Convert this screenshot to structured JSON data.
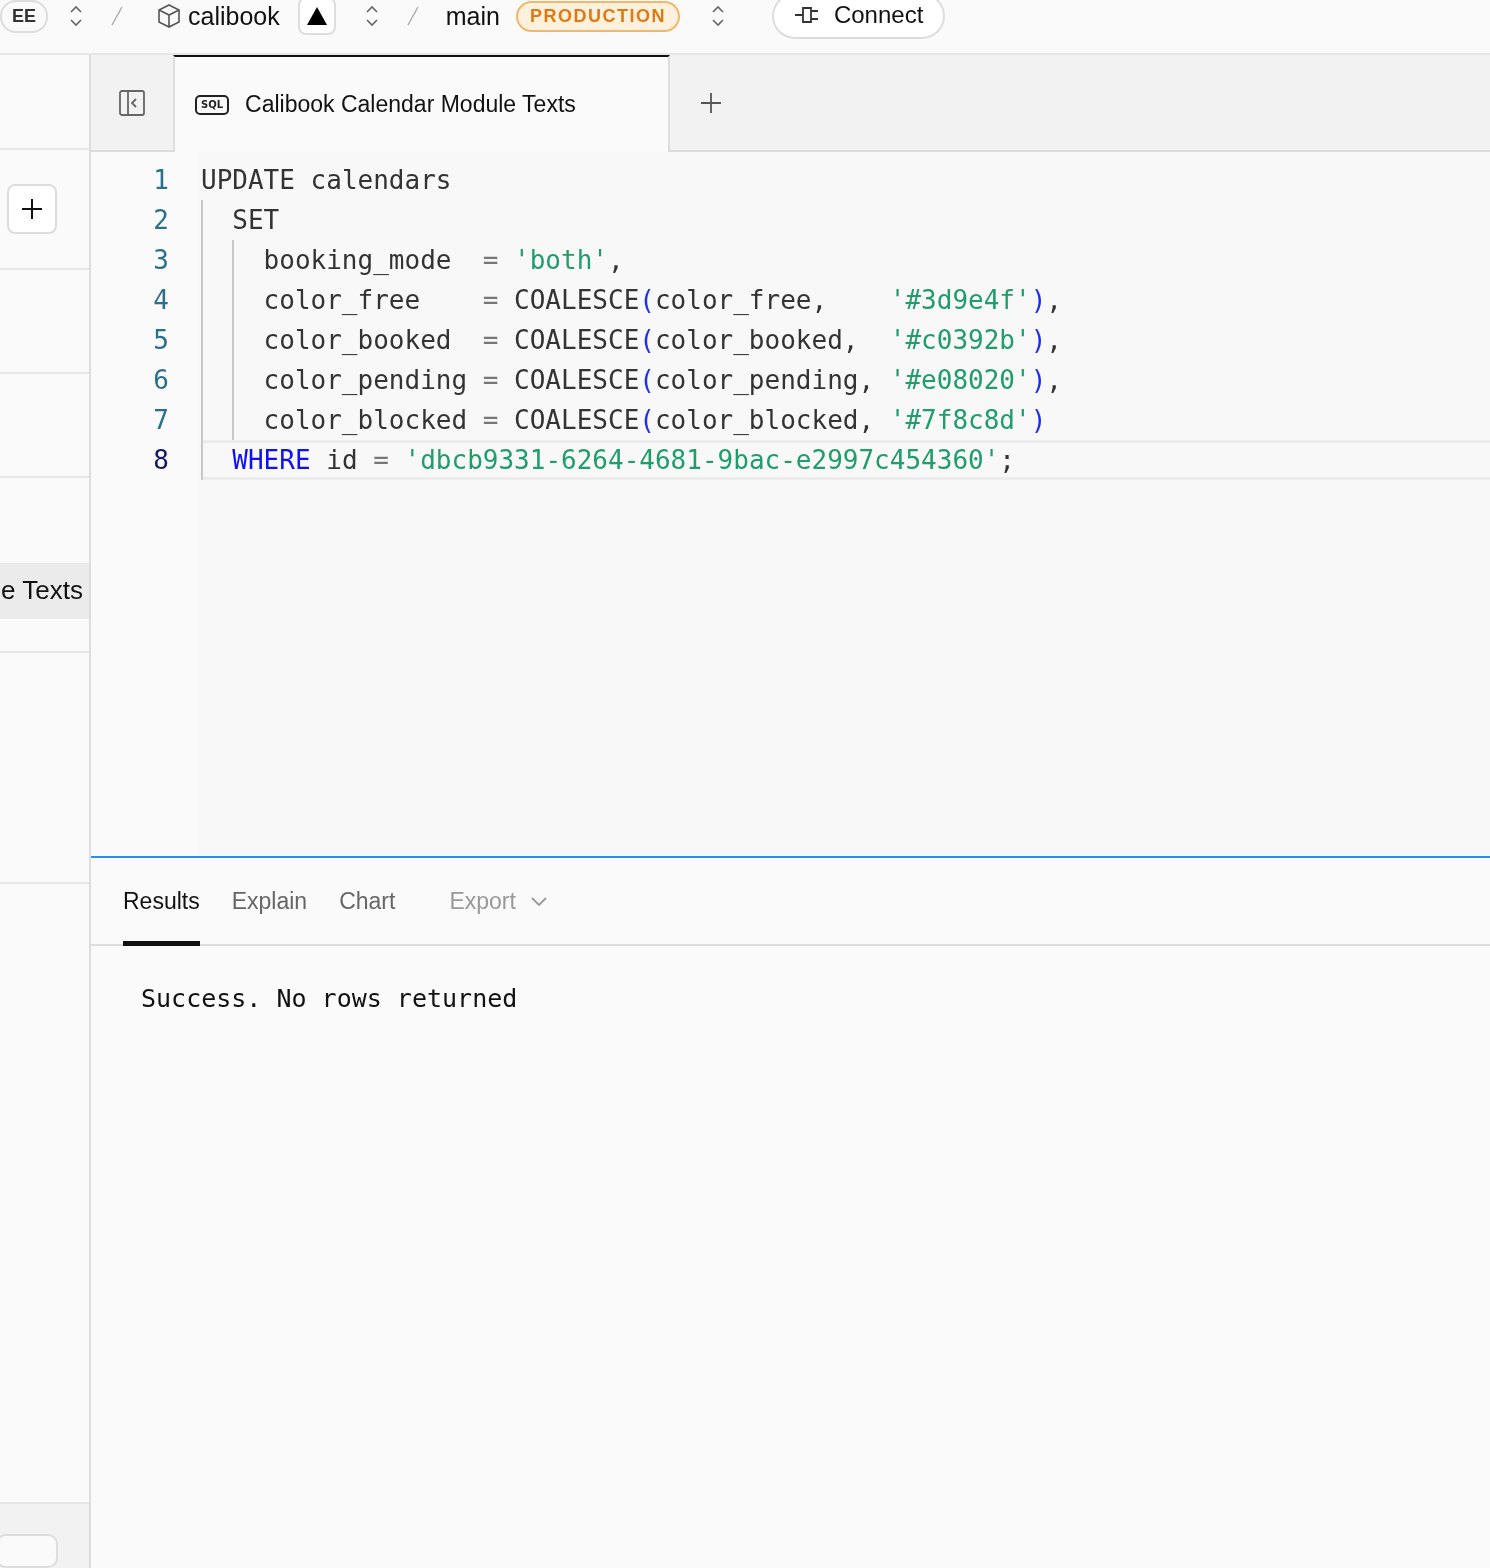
{
  "topbar": {
    "org_badge": "EE",
    "project": "calibook",
    "branch": "main",
    "environment": "PRODUCTION",
    "connect_button": "Connect"
  },
  "sidebar": {
    "items": [
      {
        "label": "e Texts",
        "selected": true
      }
    ]
  },
  "editor_tabs": [
    {
      "badge": "SQL",
      "label": "Calibook Calendar Module Texts",
      "selected": true
    }
  ],
  "editor": {
    "lines": [
      {
        "number": "1",
        "active": false,
        "tokens": [
          {
            "kind": "plain",
            "text": "UPDATE calendars"
          }
        ]
      },
      {
        "number": "2",
        "active": false,
        "tokens": [
          {
            "kind": "plain",
            "text": "  SET"
          }
        ]
      },
      {
        "number": "3",
        "active": false,
        "tokens": [
          {
            "kind": "plain",
            "text": "    booking_mode  "
          },
          {
            "kind": "operator",
            "text": "= "
          },
          {
            "kind": "string",
            "text": "'both'"
          },
          {
            "kind": "plain",
            "text": ","
          }
        ]
      },
      {
        "number": "4",
        "active": false,
        "tokens": [
          {
            "kind": "plain",
            "text": "    color_free    "
          },
          {
            "kind": "operator",
            "text": "="
          },
          {
            "kind": "plain",
            "text": " COALESCE"
          },
          {
            "kind": "paren",
            "text": "("
          },
          {
            "kind": "plain",
            "text": "color_free,    "
          },
          {
            "kind": "string",
            "text": "'#3d9e4f'"
          },
          {
            "kind": "paren",
            "text": ")"
          },
          {
            "kind": "plain",
            "text": ","
          }
        ]
      },
      {
        "number": "5",
        "active": false,
        "tokens": [
          {
            "kind": "plain",
            "text": "    color_booked  "
          },
          {
            "kind": "operator",
            "text": "="
          },
          {
            "kind": "plain",
            "text": " COALESCE"
          },
          {
            "kind": "paren",
            "text": "("
          },
          {
            "kind": "plain",
            "text": "color_booked,  "
          },
          {
            "kind": "string",
            "text": "'#c0392b'"
          },
          {
            "kind": "paren",
            "text": ")"
          },
          {
            "kind": "plain",
            "text": ","
          }
        ]
      },
      {
        "number": "6",
        "active": false,
        "tokens": [
          {
            "kind": "plain",
            "text": "    color_pending "
          },
          {
            "kind": "operator",
            "text": "="
          },
          {
            "kind": "plain",
            "text": " COALESCE"
          },
          {
            "kind": "paren",
            "text": "("
          },
          {
            "kind": "plain",
            "text": "color_pending, "
          },
          {
            "kind": "string",
            "text": "'#e08020'"
          },
          {
            "kind": "paren",
            "text": ")"
          },
          {
            "kind": "plain",
            "text": ","
          }
        ]
      },
      {
        "number": "7",
        "active": false,
        "tokens": [
          {
            "kind": "plain",
            "text": "    color_blocked "
          },
          {
            "kind": "operator",
            "text": "="
          },
          {
            "kind": "plain",
            "text": " COALESCE"
          },
          {
            "kind": "paren",
            "text": "("
          },
          {
            "kind": "plain",
            "text": "color_blocked, "
          },
          {
            "kind": "string",
            "text": "'#7f8c8d'"
          },
          {
            "kind": "paren",
            "text": ")"
          }
        ]
      },
      {
        "number": "8",
        "active": true,
        "tokens": [
          {
            "kind": "keyword",
            "text": "  WHERE"
          },
          {
            "kind": "plain",
            "text": " id "
          },
          {
            "kind": "operator",
            "text": "= "
          },
          {
            "kind": "string",
            "text": "'dbcb9331-6264-4681-9bac-e2997c454360'"
          },
          {
            "kind": "plain",
            "text": ";"
          }
        ]
      }
    ]
  },
  "results": {
    "tabs": [
      {
        "label": "Results",
        "selected": true
      },
      {
        "label": "Explain",
        "selected": false
      },
      {
        "label": "Chart",
        "selected": false
      }
    ],
    "export": {
      "label": "Export",
      "disabled": true
    },
    "message": "Success. No rows returned"
  }
}
